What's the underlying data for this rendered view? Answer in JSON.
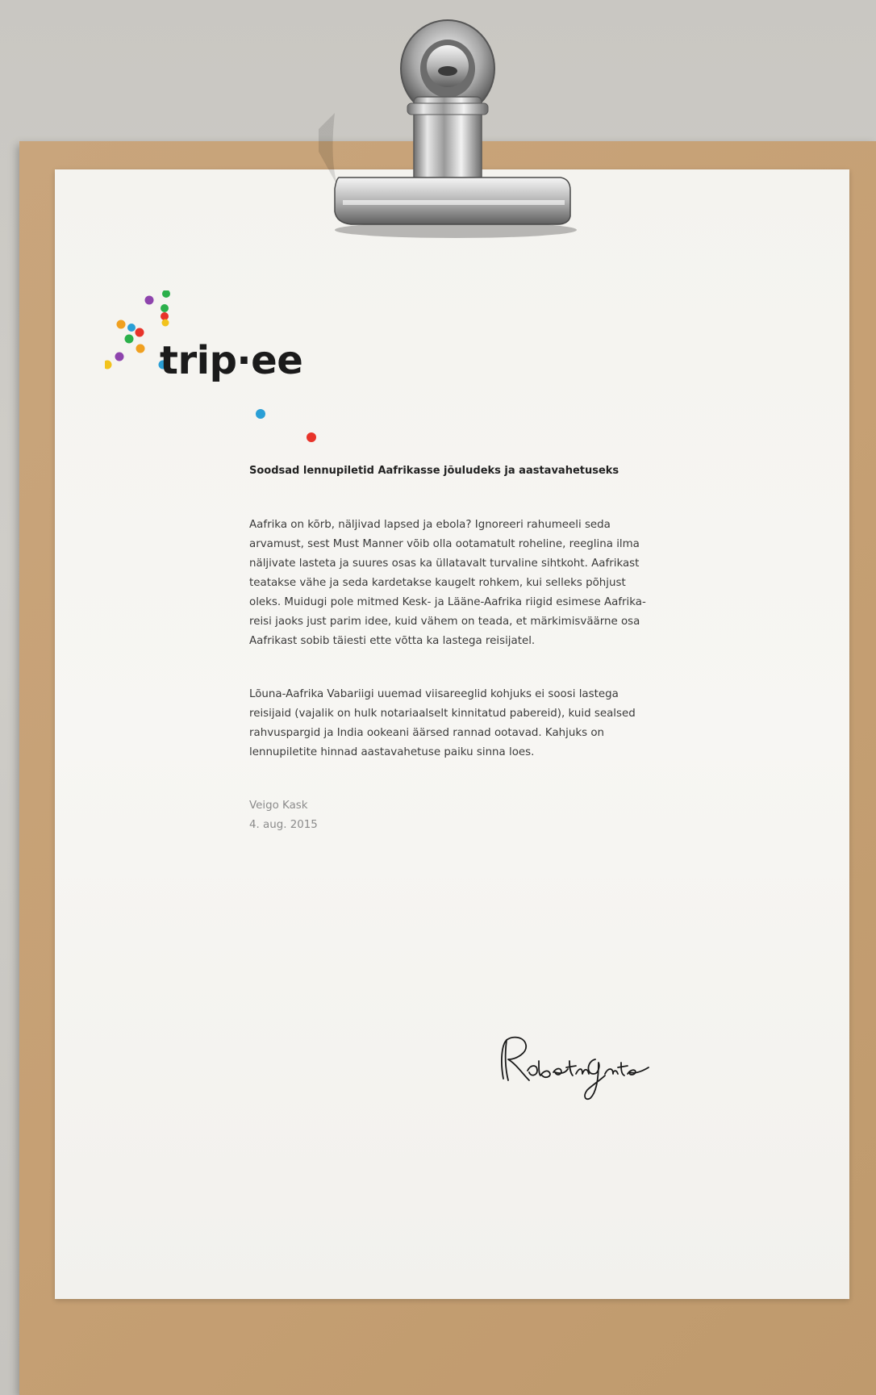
{
  "logo": {
    "text": "trip·ee",
    "dot_colors": [
      "#8e44ad",
      "#2bb04a",
      "#f0a020",
      "#e8332a",
      "#2a9fd6",
      "#f2c31c"
    ]
  },
  "letter": {
    "heading": "Soodsad lennupiletid Aafrikasse jõuludeks ja aastavahetuseks",
    "paragraph_1": "Aafrika on kõrb, näljivad lapsed ja ebola? Ignoreeri rahumeeli seda arvamust, sest Must Manner võib olla ootamatult roheline, reeglina ilma näljivate lasteta ja suures osas ka üllatavalt turvaline sihtkoht. Aafrikast teatakse vähe ja seda kardetakse kaugelt rohkem, kui selleks põhjust oleks. Muidugi pole mitmed Kesk- ja Lääne-Aafrika riigid esimese Aafrika-reisi jaoks just parim idee, kuid vähem on teada, et märkimisväärne osa Aafrikast sobib täiesti ette võtta ka lastega reisijatel.",
    "paragraph_2": "Lõuna-Aafrika Vabariigi uuemad viisareeglid kohjuks ei soosi lastega reisijaid (vajalik on hulk notariaalselt kinnitatud pabereid), kuid sealsed rahvuspargid ja India ookeani äärsed rannad ootavad. Kahjuks on lennupiletite hinnad aastavahetuse paiku sinna loes.",
    "author": "Veigo Kask",
    "date": "4. aug. 2015"
  },
  "signature": {
    "text": "Robert Gates"
  }
}
